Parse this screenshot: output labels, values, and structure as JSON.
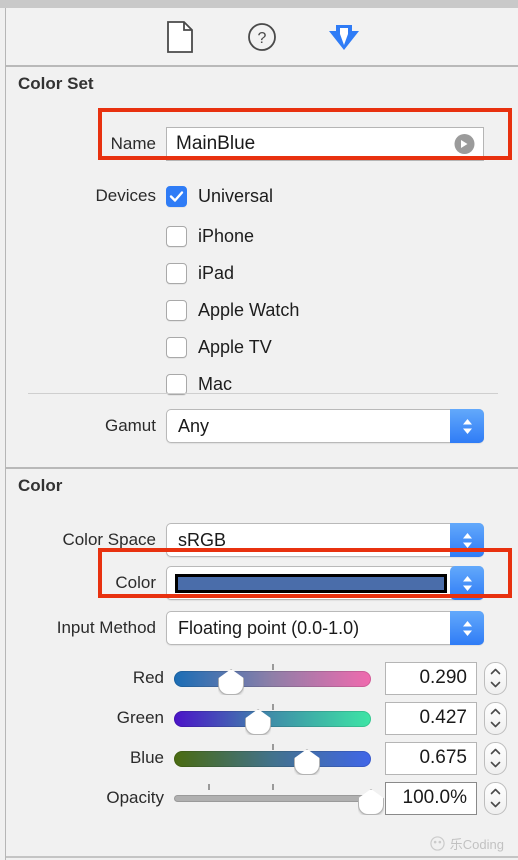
{
  "toolbar": {
    "icons": [
      {
        "name": "file-inspector-icon",
        "label": "File inspector"
      },
      {
        "name": "quick-help-icon",
        "label": "Quick Help inspector"
      },
      {
        "name": "attributes-inspector-icon",
        "label": "Attributes inspector"
      }
    ],
    "active_icon_color": "#2f7cf6"
  },
  "sections": {
    "color_set": {
      "title": "Color Set"
    },
    "color": {
      "title": "Color"
    }
  },
  "name_row": {
    "label": "Name",
    "value": "MainBlue",
    "placeholder": "Name",
    "arrow_icon": "circle-arrow-right-icon"
  },
  "devices": {
    "label": "Devices",
    "items": [
      {
        "label": "Universal",
        "checked": true
      },
      {
        "label": "iPhone",
        "checked": false
      },
      {
        "label": "iPad",
        "checked": false
      },
      {
        "label": "Apple Watch",
        "checked": false
      },
      {
        "label": "Apple TV",
        "checked": false
      },
      {
        "label": "Mac",
        "checked": false
      }
    ]
  },
  "gamut": {
    "label": "Gamut",
    "value": "Any"
  },
  "color_space": {
    "label": "Color Space",
    "value": "sRGB"
  },
  "color_well": {
    "label": "Color",
    "swatch_hex": "#4a6daa"
  },
  "input_method": {
    "label": "Input Method",
    "value": "Floating point (0.0-1.0)"
  },
  "channels": [
    {
      "label": "Red",
      "value": "0.290",
      "fraction": 0.29,
      "gradient_from": "#1a6db5",
      "gradient_mid": "#8f7fa8",
      "gradient_to": "#f06aae"
    },
    {
      "label": "Green",
      "value": "0.427",
      "fraction": 0.427,
      "gradient_from": "#4b13c8",
      "gradient_mid": "#3f8fa8",
      "gradient_to": "#3de5a5"
    },
    {
      "label": "Blue",
      "value": "0.675",
      "fraction": 0.675,
      "gradient_from": "#4a6b10",
      "gradient_mid": "#42728c",
      "gradient_to": "#4066e8"
    }
  ],
  "opacity": {
    "label": "Opacity",
    "value": "100.0%",
    "fraction": 1.0,
    "track_color": "#b0b0b0"
  },
  "annotations": {
    "color": "#e8310f",
    "boxes": [
      {
        "target": "name-row"
      },
      {
        "target": "color-row"
      }
    ]
  },
  "watermark": {
    "text": "乐Coding"
  }
}
